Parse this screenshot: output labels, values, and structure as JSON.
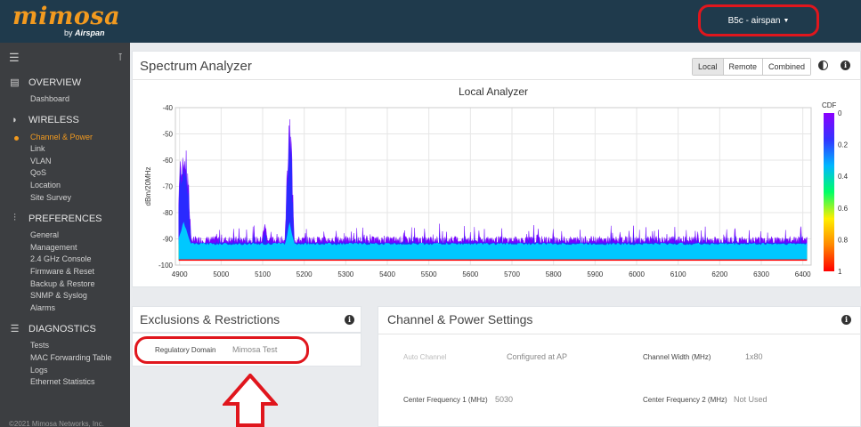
{
  "header": {
    "logo_text": "mimosa",
    "logo_by": "by",
    "logo_brand": "Airspan",
    "device_label": "B5c - airspan"
  },
  "sidebar": {
    "sections": [
      {
        "label": "OVERVIEW",
        "icon": "document-icon",
        "items": [
          "Dashboard"
        ]
      },
      {
        "label": "WIRELESS",
        "icon": "wifi-icon",
        "items": [
          "Channel & Power",
          "Link",
          "VLAN",
          "QoS",
          "Location",
          "Site Survey"
        ]
      },
      {
        "label": "PREFERENCES",
        "icon": "sliders-icon",
        "items": [
          "General",
          "Management",
          "2.4 GHz Console",
          "Firmware & Reset",
          "Backup & Restore",
          "SNMP & Syslog",
          "Alarms"
        ]
      },
      {
        "label": "DIAGNOSTICS",
        "icon": "list-icon",
        "items": [
          "Tests",
          "MAC Forwarding Table",
          "Logs",
          "Ethernet Statistics"
        ]
      }
    ],
    "active_item": "Channel & Power",
    "footer": "©2021 Mimosa Networks, Inc."
  },
  "spectrum": {
    "title": "Spectrum Analyzer",
    "buttons": [
      "Local",
      "Remote",
      "Combined"
    ],
    "selected_button": "Local"
  },
  "exclusions": {
    "title": "Exclusions & Restrictions",
    "reg_domain_label": "Regulatory Domain",
    "reg_domain_value": "Mimosa Test"
  },
  "channel": {
    "title": "Channel & Power Settings",
    "auto_channel_label": "Auto Channel",
    "auto_channel_value": "Configured at AP",
    "width_label": "Channel Width (MHz)",
    "width_value": "1x80",
    "cf1_label": "Center Frequency 1 (MHz)",
    "cf1_value": "5030",
    "cf2_label": "Center Frequency 2 (MHz)",
    "cf2_value": "Not Used"
  },
  "chart_data": {
    "type": "heatmap",
    "title": "Local  Analyzer",
    "xlabel": "",
    "ylabel": "dBm/20MHz",
    "xlim": [
      4890,
      6420
    ],
    "ylim": [
      -100,
      -40
    ],
    "x_ticks": [
      4900,
      5000,
      5100,
      5200,
      5300,
      5400,
      5500,
      5600,
      5700,
      5800,
      5900,
      6000,
      6100,
      6200,
      6300,
      6400
    ],
    "y_ticks": [
      -40,
      -50,
      -60,
      -70,
      -80,
      -90,
      -100
    ],
    "colorbar_title": "CDF",
    "colorbar_ticks": [
      0,
      0.2,
      0.4,
      0.6,
      0.8,
      1
    ],
    "colorscale": [
      "#8b00ff",
      "#3333ff",
      "#00b7ff",
      "#00ff66",
      "#ffee00",
      "#ff8800",
      "#ff0000"
    ],
    "noise_floor_dbm": -91,
    "peaks": [
      {
        "x": 4910,
        "y": -47,
        "width": 35
      },
      {
        "x": 5105,
        "y": -84,
        "width": 14
      },
      {
        "x": 5165,
        "y": -44,
        "width": 22
      }
    ]
  }
}
